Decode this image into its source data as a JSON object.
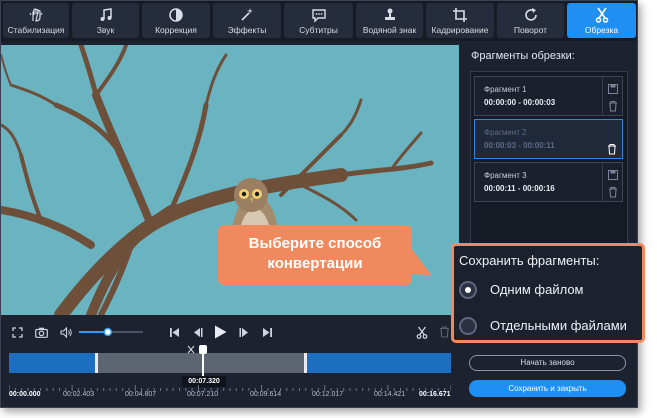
{
  "toolbar": {
    "tabs": [
      {
        "label": "Стабилизация",
        "icon": "stabilization-hand-icon"
      },
      {
        "label": "Звук",
        "icon": "music-note-icon"
      },
      {
        "label": "Коррекция",
        "icon": "contrast-icon"
      },
      {
        "label": "Эффекты",
        "icon": "magic-wand-icon"
      },
      {
        "label": "Субтитры",
        "icon": "speech-bubble-icon"
      },
      {
        "label": "Водяной знак",
        "icon": "stamp-icon"
      },
      {
        "label": "Кадрирование",
        "icon": "crop-icon"
      },
      {
        "label": "Поворот",
        "icon": "rotate-icon"
      },
      {
        "label": "Обрезка",
        "icon": "scissors-icon"
      }
    ],
    "active": "Обрезка"
  },
  "fragments": {
    "title": "Фрагменты обрезки:",
    "items": [
      {
        "name": "Фрагмент 1",
        "range": "00:00:00 - 00:00:03"
      },
      {
        "name": "Фрагмент 2",
        "range": "00:00:03 - 00:00:11"
      },
      {
        "name": "Фрагмент 3",
        "range": "00:00:11 - 00:00:16"
      }
    ],
    "selected_index": 1
  },
  "save": {
    "title": "Сохранить фрагменты:",
    "options": [
      "Одним файлом",
      "Отдельными файлами"
    ],
    "selected": "Одним файлом"
  },
  "callout": {
    "line1": "Выберите способ",
    "line2": "конвертации",
    "color": "#f08a5e"
  },
  "buttons": {
    "restart": "Начать заново",
    "save_close": "Сохранить и закрыть"
  },
  "player": {
    "volume_level": 0.45
  },
  "timeline": {
    "current_time": "00:07.320",
    "labels": [
      "00:00.000",
      "00:02.403",
      "00:04.807",
      "00:07.210",
      "00:09.614",
      "00:12.017",
      "00:14.421",
      "00:16.671"
    ]
  },
  "colors": {
    "accent": "#1f8ff3",
    "panel": "#1c2230",
    "highlight": "#f08a5e"
  }
}
